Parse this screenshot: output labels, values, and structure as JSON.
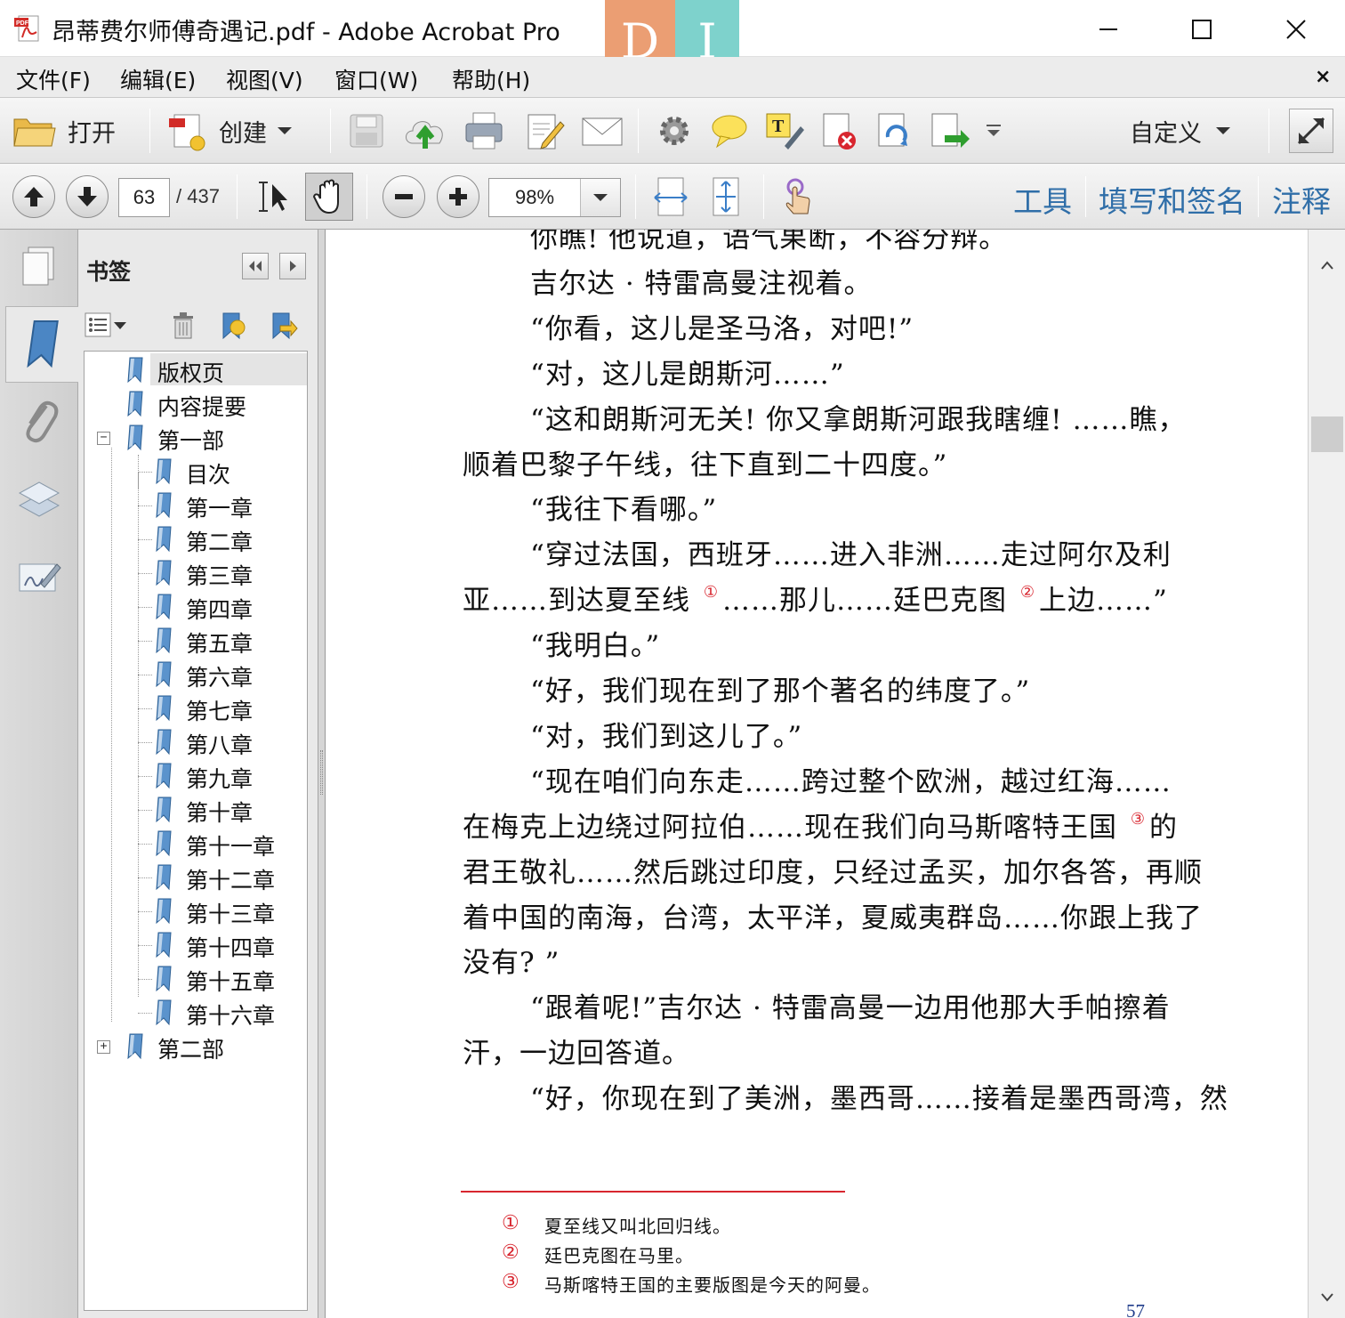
{
  "window": {
    "title": "昂蒂费尔师傅奇遇记.pdf - Adobe Acrobat Pro",
    "watermark_left": "D",
    "watermark_right": "I"
  },
  "menu": {
    "items": [
      "文件(F)",
      "编辑(E)",
      "视图(V)",
      "窗口(W)",
      "帮助(H)"
    ],
    "close_glyph": "×"
  },
  "toolbar": {
    "open_label": "打开",
    "create_label": "创建",
    "customize_label": "自定义"
  },
  "nav": {
    "current_page": "63",
    "total_pages": "/ 437",
    "zoom": "98%",
    "panel_links": [
      "工具",
      "填写和签名",
      "注释"
    ]
  },
  "bookmarks": {
    "title": "书签",
    "items": [
      {
        "label": "版权页",
        "level": 0,
        "selected": true
      },
      {
        "label": "内容提要",
        "level": 0
      },
      {
        "label": "第一部",
        "level": 0,
        "expander": "−"
      },
      {
        "label": "目次",
        "level": 1
      },
      {
        "label": "第一章",
        "level": 1
      },
      {
        "label": "第二章",
        "level": 1
      },
      {
        "label": "第三章",
        "level": 1
      },
      {
        "label": "第四章",
        "level": 1
      },
      {
        "label": "第五章",
        "level": 1
      },
      {
        "label": "第六章",
        "level": 1
      },
      {
        "label": "第七章",
        "level": 1
      },
      {
        "label": "第八章",
        "level": 1
      },
      {
        "label": "第九章",
        "level": 1
      },
      {
        "label": "第十章",
        "level": 1
      },
      {
        "label": "第十一章",
        "level": 1
      },
      {
        "label": "第十二章",
        "level": 1
      },
      {
        "label": "第十三章",
        "level": 1
      },
      {
        "label": "第十四章",
        "level": 1
      },
      {
        "label": "第十五章",
        "level": 1
      },
      {
        "label": "第十六章",
        "level": 1
      },
      {
        "label": "第二部",
        "level": 0,
        "expander": "+"
      }
    ]
  },
  "document": {
    "lines": [
      {
        "text": "你瞧!  他说道，语气果断，不容分辩。",
        "indent": true
      },
      {
        "text": "吉尔达 · 特雷高曼注视着。",
        "indent": true
      },
      {
        "text": "“你看，这儿是圣马洛，对吧!”",
        "indent": true
      },
      {
        "text": "“对，这儿是朗斯河……”",
        "indent": true
      },
      {
        "text": "“这和朗斯河无关! 你又拿朗斯河跟我瞎缠! ……瞧，",
        "indent": true
      },
      {
        "text": "顺着巴黎子午线，往下直到二十四度。”",
        "indent": false
      },
      {
        "text": "“我往下看哪。”",
        "indent": true
      },
      {
        "text": "“穿过法国，西班牙……进入非洲……走过阿尔及利",
        "indent": true
      },
      {
        "text": "亚……到达夏至线 {1}……那儿……廷巴克图 {2}上边……”",
        "indent": false
      },
      {
        "text": "“我明白。”",
        "indent": true
      },
      {
        "text": "“好，我们现在到了那个著名的纬度了。”",
        "indent": true
      },
      {
        "text": "“对，我们到这儿了。”",
        "indent": true
      },
      {
        "text": "“现在咱们向东走……跨过整个欧洲，越过红海……",
        "indent": true
      },
      {
        "text": "在梅克上边绕过阿拉伯……现在我们向马斯喀特王国 {3}的",
        "indent": false
      },
      {
        "text": "君王敬礼……然后跳过印度，只经过孟买，加尔各答，再顺",
        "indent": false
      },
      {
        "text": "着中国的南海，台湾，太平洋，夏威夷群岛……你跟上我了",
        "indent": false
      },
      {
        "text": "没有? ”",
        "indent": false
      },
      {
        "text": "“跟着呢!”吉尔达 · 特雷高曼一边用他那大手帕擦着",
        "indent": true
      },
      {
        "text": "汗，一边回答道。",
        "indent": false
      },
      {
        "text": "“好，你现在到了美洲，墨西哥……接着是墨西哥湾，然",
        "indent": true
      }
    ],
    "footnote_marks": [
      "①",
      "②",
      "③"
    ],
    "footnotes": [
      {
        "num": "①",
        "text": "夏至线又叫北回归线。"
      },
      {
        "num": "②",
        "text": "廷巴克图在马里。"
      },
      {
        "num": "③",
        "text": "马斯喀特王国的主要版图是今天的阿曼。"
      }
    ],
    "page_number": "57"
  },
  "colors": {
    "accent_link": "#2f6ea8",
    "footnote_red": "#d8262f",
    "pdf_red": "#d22b27"
  }
}
